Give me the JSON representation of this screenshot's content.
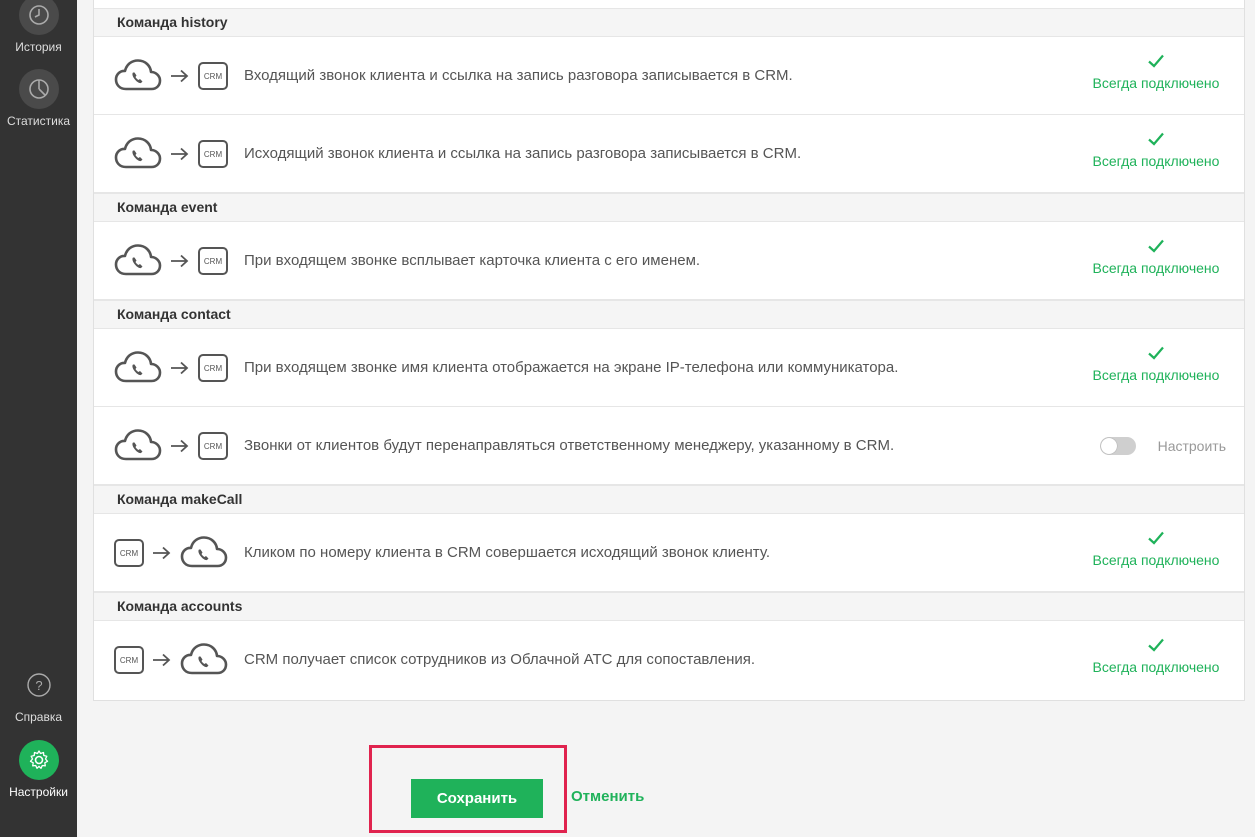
{
  "sidebar": {
    "items": [
      {
        "label": "История",
        "icon": "clock-icon"
      },
      {
        "label": "Статистика",
        "icon": "pie-chart-icon"
      },
      {
        "label": "Справка",
        "icon": "help-icon"
      },
      {
        "label": "Настройки",
        "icon": "gear-icon"
      }
    ]
  },
  "sections": [
    {
      "title": "Команда history"
    },
    {
      "title": "Команда event"
    },
    {
      "title": "Команда contact"
    },
    {
      "title": "Команда makeCall"
    },
    {
      "title": "Команда accounts"
    }
  ],
  "rows": [
    {
      "flow": "cloud-to-crm",
      "text": "Входящий звонок клиента и ссылка на запись разговора записывается в CRM.",
      "status": "Всегда подключено"
    },
    {
      "flow": "cloud-to-crm",
      "text": "Исходящий звонок клиента и ссылка на запись разговора записывается в CRM.",
      "status": "Всегда подключено"
    },
    {
      "flow": "cloud-to-crm",
      "text": "При входящем звонке всплывает карточка клиента с его именем.",
      "status": "Всегда подключено"
    },
    {
      "flow": "cloud-to-crm",
      "text": "При входящем звонке имя клиента отображается на экране IP-телефона или коммуникатора.",
      "status": "Всегда подключено"
    },
    {
      "flow": "cloud-to-crm",
      "text": "Звонки от клиентов будут перенаправляться ответственному менеджеру, указанному в CRM.",
      "setup": "Настроить",
      "toggle_on": false
    },
    {
      "flow": "crm-to-cloud",
      "text": "Кликом по номеру клиента в CRM совершается исходящий звонок клиенту.",
      "status": "Всегда подключено"
    },
    {
      "flow": "crm-to-cloud",
      "text": "CRM получает список сотрудников из Облачной АТС для сопоставления.",
      "status": "Всегда подключено"
    }
  ],
  "crm_label": "CRM",
  "footer": {
    "save_label": "Сохранить",
    "cancel_label": "Отменить"
  },
  "colors": {
    "accent": "#1fb25a",
    "sidebar": "#333333",
    "highlight": "#e0234e"
  }
}
